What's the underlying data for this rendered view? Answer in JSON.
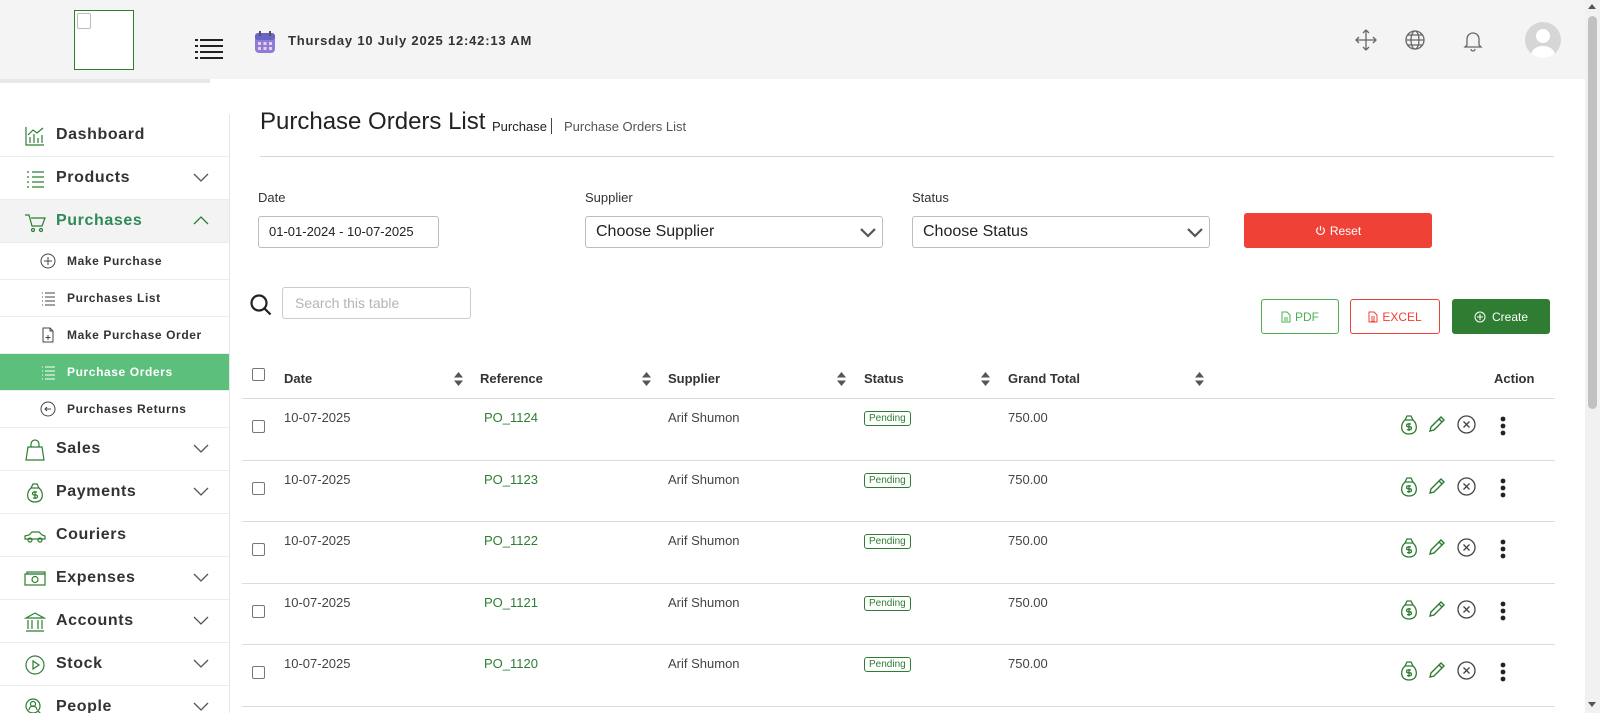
{
  "header": {
    "datetime": "Thursday 10 July 2025 12:42:13 AM"
  },
  "sidebar": {
    "items": [
      {
        "label": "Dashboard",
        "icon": "chart-icon"
      },
      {
        "label": "Products",
        "icon": "list-icon"
      },
      {
        "label": "Purchases",
        "icon": "cart-icon"
      },
      {
        "label": "Sales",
        "icon": "bag-icon"
      },
      {
        "label": "Payments",
        "icon": "money-bag-icon"
      },
      {
        "label": "Couriers",
        "icon": "car-icon"
      },
      {
        "label": "Expenses",
        "icon": "cash-icon"
      },
      {
        "label": "Accounts",
        "icon": "bank-icon"
      },
      {
        "label": "Stock",
        "icon": "play-circle-icon"
      },
      {
        "label": "People",
        "icon": "person-search-icon"
      }
    ],
    "purchases_sub": [
      {
        "label": "Make Purchase"
      },
      {
        "label": "Purchases List"
      },
      {
        "label": "Make Purchase Order"
      },
      {
        "label": "Purchase Orders"
      },
      {
        "label": "Purchases Returns"
      }
    ],
    "active_sub": "Purchase Orders"
  },
  "page": {
    "title": "Purchase Orders List",
    "breadcrumb_parent": "Purchase",
    "breadcrumb_current": "Purchase Orders List"
  },
  "filters": {
    "date_label": "Date",
    "date_value": "01-01-2024 - 10-07-2025",
    "supplier_label": "Supplier",
    "supplier_value": "Choose Supplier",
    "status_label": "Status",
    "status_value": "Choose Status",
    "reset_label": "Reset"
  },
  "toolbar": {
    "search_placeholder": "Search this table",
    "pdf_label": "PDF",
    "excel_label": "EXCEL",
    "create_label": "Create"
  },
  "table": {
    "columns": [
      "Date",
      "Reference",
      "Supplier",
      "Status",
      "Grand Total",
      "Action"
    ],
    "rows": [
      {
        "date": "10-07-2025",
        "reference": "PO_1124",
        "supplier": "Arif Shumon",
        "status": "Pending",
        "grand_total": "750.00"
      },
      {
        "date": "10-07-2025",
        "reference": "PO_1123",
        "supplier": "Arif Shumon",
        "status": "Pending",
        "grand_total": "750.00"
      },
      {
        "date": "10-07-2025",
        "reference": "PO_1122",
        "supplier": "Arif Shumon",
        "status": "Pending",
        "grand_total": "750.00"
      },
      {
        "date": "10-07-2025",
        "reference": "PO_1121",
        "supplier": "Arif Shumon",
        "status": "Pending",
        "grand_total": "750.00"
      },
      {
        "date": "10-07-2025",
        "reference": "PO_1120",
        "supplier": "Arif Shumon",
        "status": "Pending",
        "grand_total": "750.00"
      }
    ]
  },
  "colors": {
    "brand_green": "#2e7d32",
    "active_sub_bg": "#5cbf7c",
    "danger": "#ef4136"
  }
}
